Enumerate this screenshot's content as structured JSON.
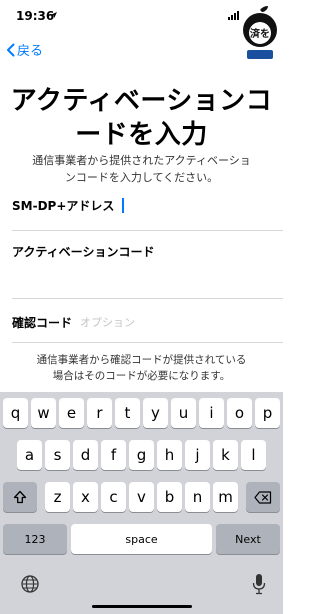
{
  "status_bar": {
    "time": "19:36",
    "time_arrow_icon": "location-arrow-icon",
    "signal_icon": "signal-bars-icon"
  },
  "watermark": {
    "text": "済を"
  },
  "nav": {
    "back_label": "戻る",
    "back_icon": "chevron-left-icon"
  },
  "title_lines": [
    "アクティベーションコ",
    "ードを入力"
  ],
  "subtitle_lines": [
    "通信事業者から提供されたアクティベーショ",
    "ンコードを入力してください。"
  ],
  "form": {
    "sm_dp_label": "SM-DP+アドレス",
    "activation_code_label": "アクティベーションコード",
    "confirmation_code_label": "確認コード",
    "confirmation_code_placeholder": "オプション"
  },
  "footnote_lines": [
    "通信事業者から確認コードが提供されている",
    "場合はそのコードが必要になります。"
  ],
  "keyboard": {
    "row1": [
      "q",
      "w",
      "e",
      "r",
      "t",
      "y",
      "u",
      "i",
      "o",
      "p"
    ],
    "row2": [
      "a",
      "s",
      "d",
      "f",
      "g",
      "h",
      "j",
      "k",
      "l"
    ],
    "row3": [
      "z",
      "x",
      "c",
      "v",
      "b",
      "n",
      "m"
    ],
    "shift_icon": "shift-icon",
    "delete_icon": "delete-icon",
    "numbers_label": "123",
    "space_label": "space",
    "next_label": "Next",
    "globe_icon": "globe-icon",
    "mic_icon": "microphone-icon"
  },
  "colors": {
    "accent": "#007aff",
    "keyboard_bg": "#d1d3d9",
    "key_bg": "#ffffff",
    "dark_key_bg": "#aeb3bb",
    "separator": "#d6d6d8"
  }
}
